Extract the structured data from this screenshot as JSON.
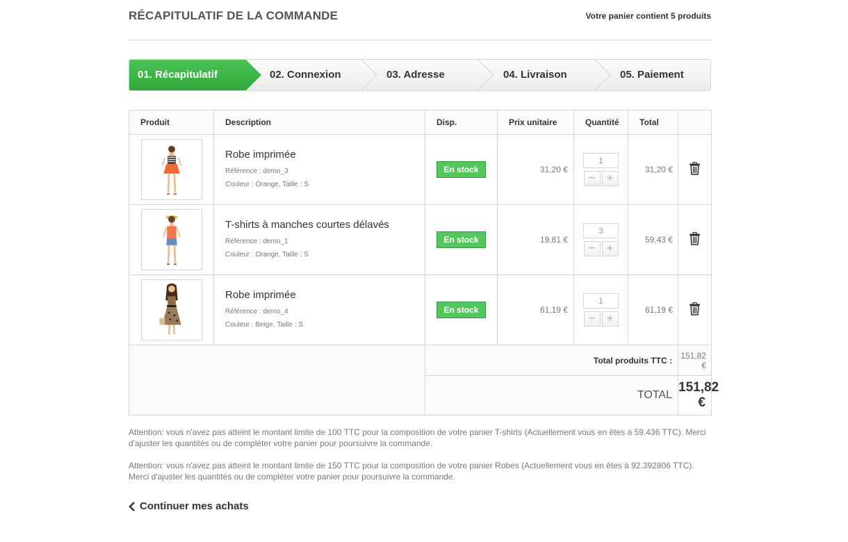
{
  "header": {
    "title": "RÉCAPITULATIF DE LA COMMANDE",
    "cart_count": "Votre panier contient 5 produits"
  },
  "steps": [
    {
      "label": "01. Récapitulatif",
      "active": true
    },
    {
      "label": "02. Connexion",
      "active": false
    },
    {
      "label": "03. Adresse",
      "active": false
    },
    {
      "label": "04. Livraison",
      "active": false
    },
    {
      "label": "05. Paiement",
      "active": false
    }
  ],
  "table": {
    "headers": {
      "product": "Produit",
      "description": "Description",
      "availability": "Disp.",
      "unit_price": "Prix unitaire",
      "quantity": "Quantité",
      "total": "Total"
    },
    "rows": [
      {
        "name": "Robe imprimée",
        "reference": "Référence : demo_3",
        "attributes": "Couleur : Orange, Taille : S",
        "availability": "En stock",
        "unit_price": "31,20 €",
        "quantity": "1",
        "total": "31,20 €"
      },
      {
        "name": "T-shirts à manches courtes délavés",
        "reference": "Référence : demo_1",
        "attributes": "Couleur : Orange, Taille : S",
        "availability": "En stock",
        "unit_price": "19,81 €",
        "quantity": "3",
        "total": "59,43 €"
      },
      {
        "name": "Robe imprimée",
        "reference": "Référence : demo_4",
        "attributes": "Couleur : Beige, Taille : S",
        "availability": "En stock",
        "unit_price": "61,19 €",
        "quantity": "1",
        "total": "61,19 €"
      }
    ],
    "footer": {
      "products_label": "Total produits TTC :",
      "products_value": "151,82 €",
      "total_label": "TOTAL",
      "total_value": "151,82 €"
    }
  },
  "warnings": [
    "Attention: vous n'avez pas atteint le montant limite de 100 TTC pour la composition de votre panier T-shirts (Actuellement vous en êtes à 59.436 TTC). Merci d'ajuster les quantités ou de compléter votre panier pour poursuivre la commande.",
    "Attention: vous n'avez pas atteint le montant limite de 150 TTC pour la composition de votre panier Robes (Actuellement vous en êtes à 92.392806 TTC). Merci d'ajuster les quantités ou de compléter votre panier pour poursuivre la commande."
  ],
  "continue_label": "Continuer mes achats",
  "icons": {
    "qty_minus": "minus-icon",
    "qty_plus": "plus-icon",
    "delete": "trash-icon",
    "continue": "chevron-left-icon"
  },
  "colors": {
    "active_step": "#3bb54a",
    "stock_badge": "#55c65e",
    "border": "#d6d4d4"
  }
}
